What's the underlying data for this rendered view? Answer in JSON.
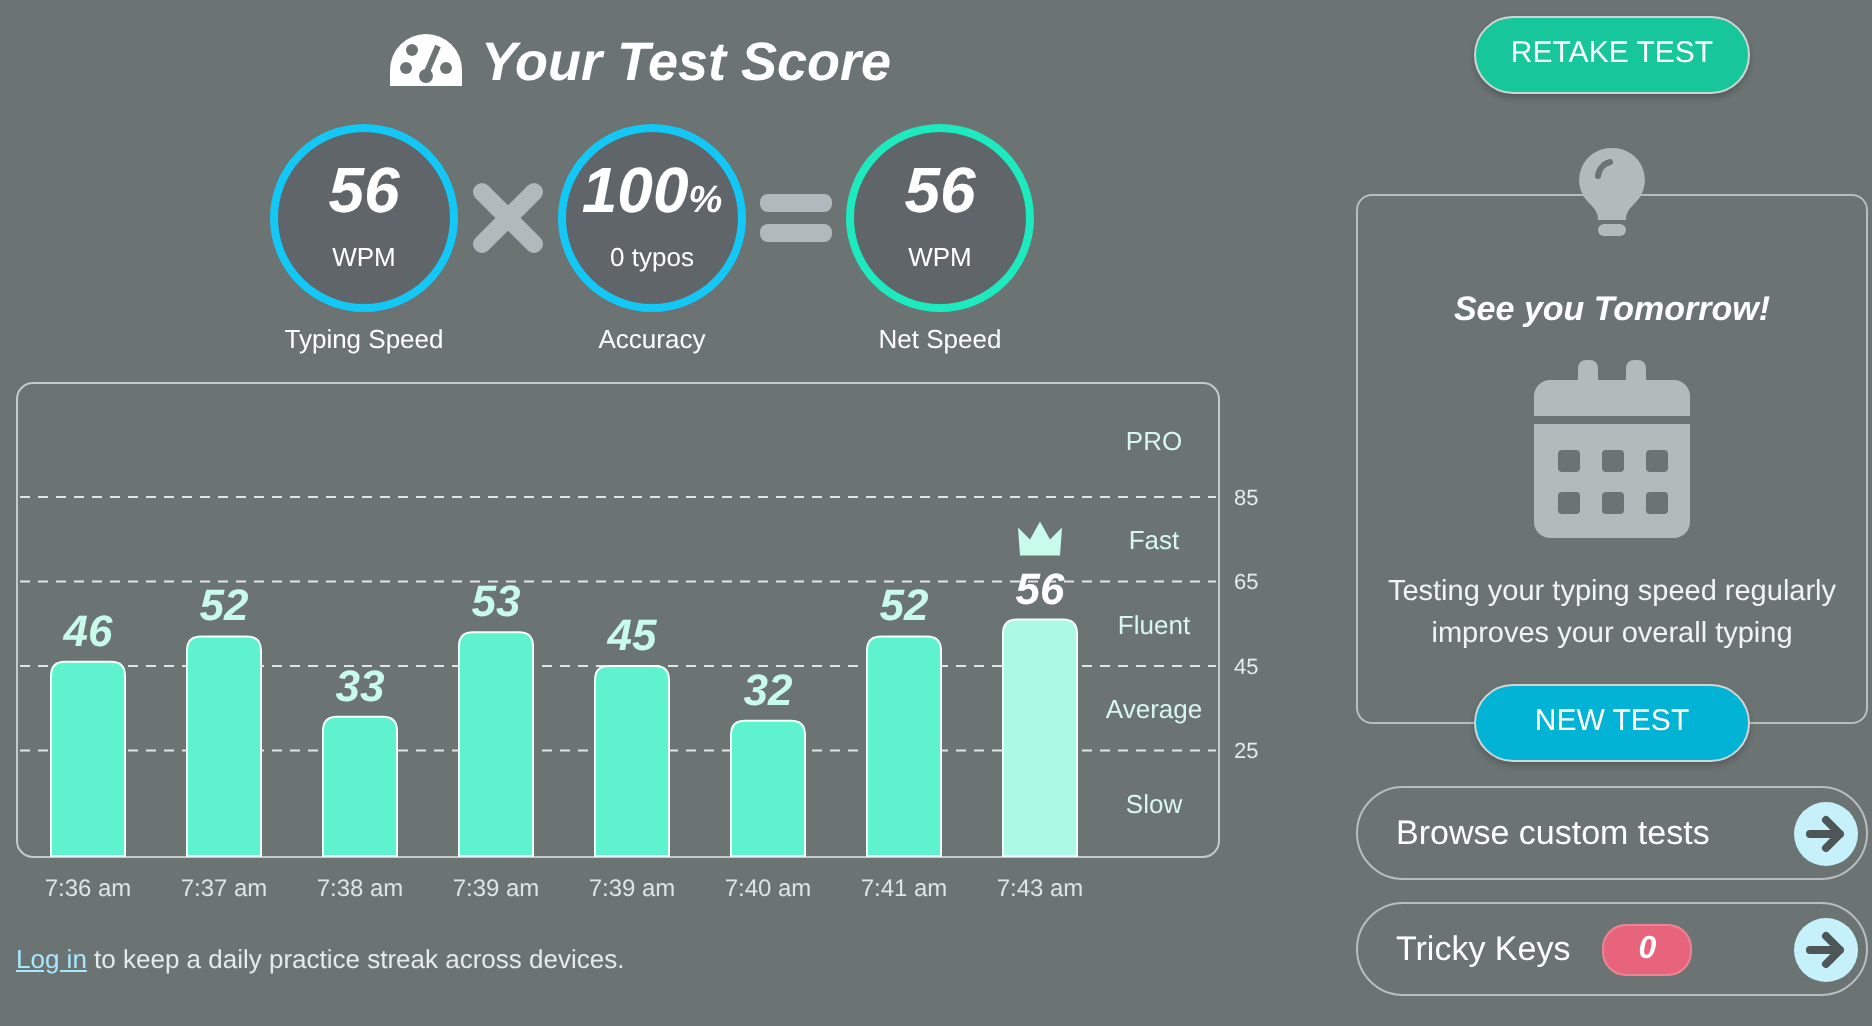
{
  "title": "Your Test Score",
  "scores": [
    {
      "value": "56",
      "unit": "WPM",
      "label": "Typing Speed",
      "kind": "speed"
    },
    {
      "value": "100",
      "suffix": "%",
      "unit": "0 typos",
      "label": "Accuracy",
      "kind": "accuracy"
    },
    {
      "value": "56",
      "unit": "WPM",
      "label": "Net Speed",
      "kind": "net"
    }
  ],
  "chart": {
    "chart_data": {
      "type": "bar",
      "categories": [
        "7:36 am",
        "7:37 am",
        "7:38 am",
        "7:39 am",
        "7:39 am",
        "7:40 am",
        "7:41 am",
        "7:43 am"
      ],
      "values": [
        46,
        52,
        33,
        53,
        45,
        32,
        52,
        56
      ],
      "ylim": [
        0,
        112
      ],
      "yticks": [
        25,
        45,
        65,
        85
      ],
      "grid": true,
      "data_labels": true
    },
    "bars": [
      {
        "best": false
      },
      {
        "best": false
      },
      {
        "best": false
      },
      {
        "best": false
      },
      {
        "best": false
      },
      {
        "best": false
      },
      {
        "best": false
      },
      {
        "best": true
      }
    ],
    "zones": [
      "PRO",
      "Fast",
      "Fluent",
      "Average",
      "Slow"
    ]
  },
  "login": {
    "link": "Log in",
    "text": "to keep a daily practice streak across devices."
  },
  "retake_button": "RETAKE TEST",
  "tip_card": {
    "heading": "See you Tomorrow!",
    "text": "Testing your typing speed regularly improves your overall typing",
    "button": "NEW TEST"
  },
  "links": [
    {
      "label": "Browse custom tests"
    },
    {
      "label": "Tricky Keys",
      "badge": "0"
    }
  ]
}
